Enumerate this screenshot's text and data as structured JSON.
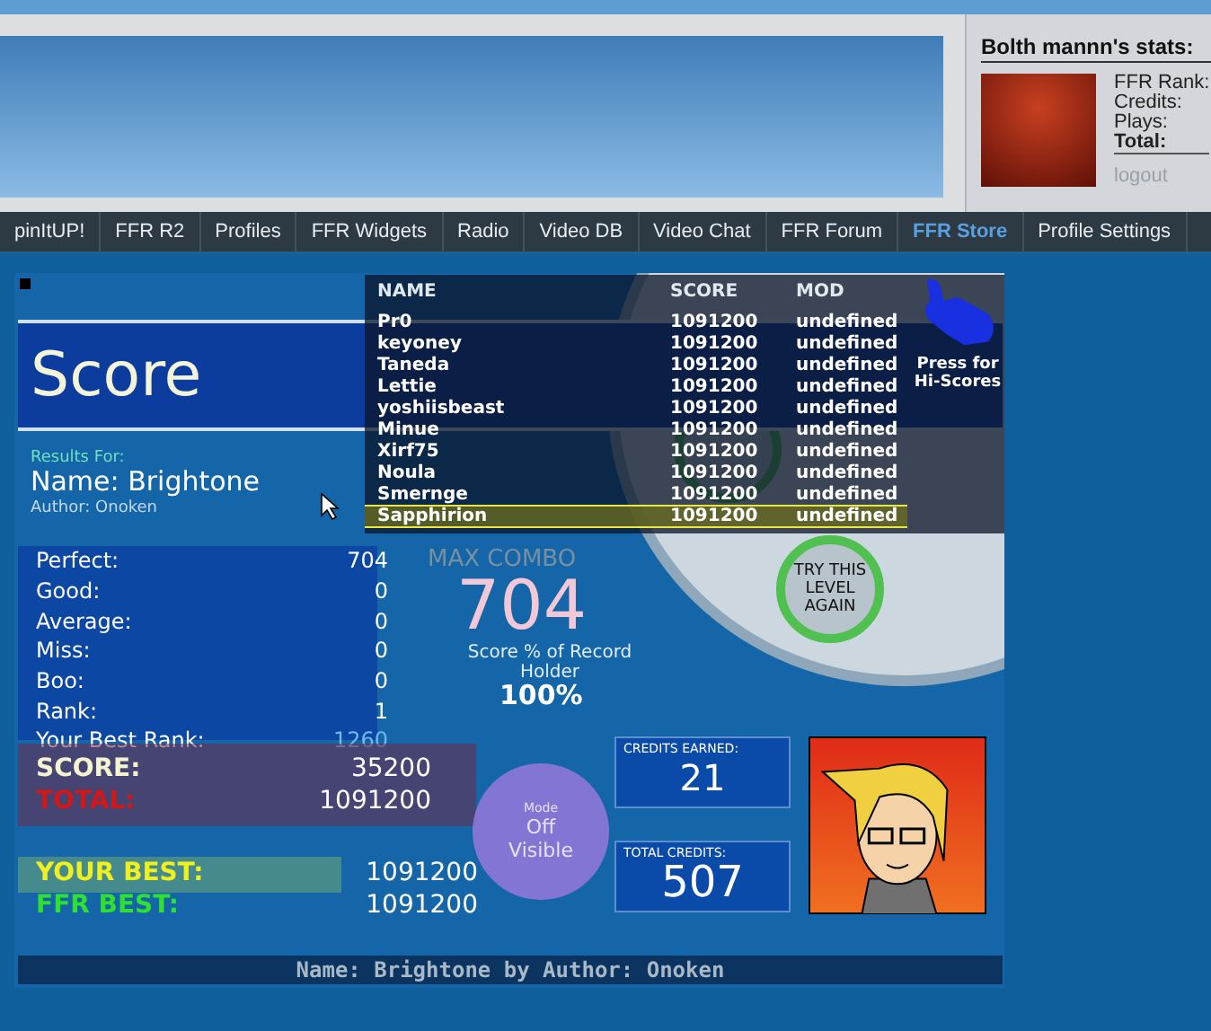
{
  "user_panel": {
    "title": "Bolth mannn's stats:",
    "stats": [
      {
        "label": "FFR Rank:",
        "bold": false
      },
      {
        "label": "Credits:",
        "bold": false
      },
      {
        "label": "Plays:",
        "bold": false
      },
      {
        "label": "Total:",
        "bold": true
      }
    ],
    "logout": "logout"
  },
  "nav": [
    {
      "label": "pinItUP!",
      "selected": false
    },
    {
      "label": "FFR R2",
      "selected": false
    },
    {
      "label": "Profiles",
      "selected": false
    },
    {
      "label": "FFR Widgets",
      "selected": false
    },
    {
      "label": "Radio",
      "selected": false
    },
    {
      "label": "Video DB",
      "selected": false
    },
    {
      "label": "Video Chat",
      "selected": false
    },
    {
      "label": "FFR Forum",
      "selected": false
    },
    {
      "label": "FFR Store",
      "selected": true
    },
    {
      "label": "Profile Settings",
      "selected": false
    }
  ],
  "game": {
    "title": "Score",
    "results_for": "Results For:",
    "name": "Name: Brightone",
    "author": "Author: Onoken",
    "judgements": [
      {
        "label": "Perfect:",
        "value": "704"
      },
      {
        "label": "Good:",
        "value": "0"
      },
      {
        "label": "Average:",
        "value": "0"
      },
      {
        "label": "Miss:",
        "value": "0"
      },
      {
        "label": "Boo:",
        "value": "0"
      },
      {
        "label": "Rank:",
        "value": "1"
      },
      {
        "label": "Your Best Rank:",
        "value": "1260"
      }
    ],
    "max_combo": {
      "label": "MAX COMBO",
      "value": "704"
    },
    "record": {
      "label": "Score % of Record Holder",
      "value": "100%"
    },
    "score_rows": [
      {
        "label": "SCORE:",
        "value": "35200",
        "color": "#f4f4d0"
      },
      {
        "label": "TOTAL:",
        "value": "1091200",
        "color": "#d01818"
      }
    ],
    "best_rows": [
      {
        "label": "YOUR BEST:",
        "value": "1091200",
        "color": "#f0f020"
      },
      {
        "label": "FFR BEST:",
        "value": "1091200",
        "color": "#30e030"
      }
    ],
    "mode": {
      "label": "Mode",
      "value": "Off",
      "setting": "Visible"
    },
    "credits": [
      {
        "label": "CREDITS EARNED:",
        "value": "21"
      },
      {
        "label": "TOTAL CREDITS:",
        "value": "507"
      }
    ],
    "retry_button": "TRY THIS LEVEL AGAIN",
    "footer": "Name: Brightone by Author: Onoken",
    "hiscores": {
      "columns": [
        "NAME",
        "SCORE",
        "MOD"
      ],
      "press_hint": "Press for Hi-Scores",
      "rows": [
        {
          "name": "Pr0",
          "score": "1091200",
          "mods": "undefined",
          "selected": false
        },
        {
          "name": "keyoney",
          "score": "1091200",
          "mods": "undefined",
          "selected": false
        },
        {
          "name": "Taneda",
          "score": "1091200",
          "mods": "undefined",
          "selected": false
        },
        {
          "name": "Lettie",
          "score": "1091200",
          "mods": "undefined",
          "selected": false
        },
        {
          "name": "yoshiisbeast",
          "score": "1091200",
          "mods": "undefined",
          "selected": false
        },
        {
          "name": "Minue",
          "score": "1091200",
          "mods": "undefined",
          "selected": false
        },
        {
          "name": "Xirf75",
          "score": "1091200",
          "mods": "undefined",
          "selected": false
        },
        {
          "name": "Noula",
          "score": "1091200",
          "mods": "undefined",
          "selected": false
        },
        {
          "name": "Smernge",
          "score": "1091200",
          "mods": "undefined",
          "selected": false
        },
        {
          "name": "Sapphirion",
          "score": "1091200",
          "mods": "undefined",
          "selected": true
        }
      ]
    }
  }
}
